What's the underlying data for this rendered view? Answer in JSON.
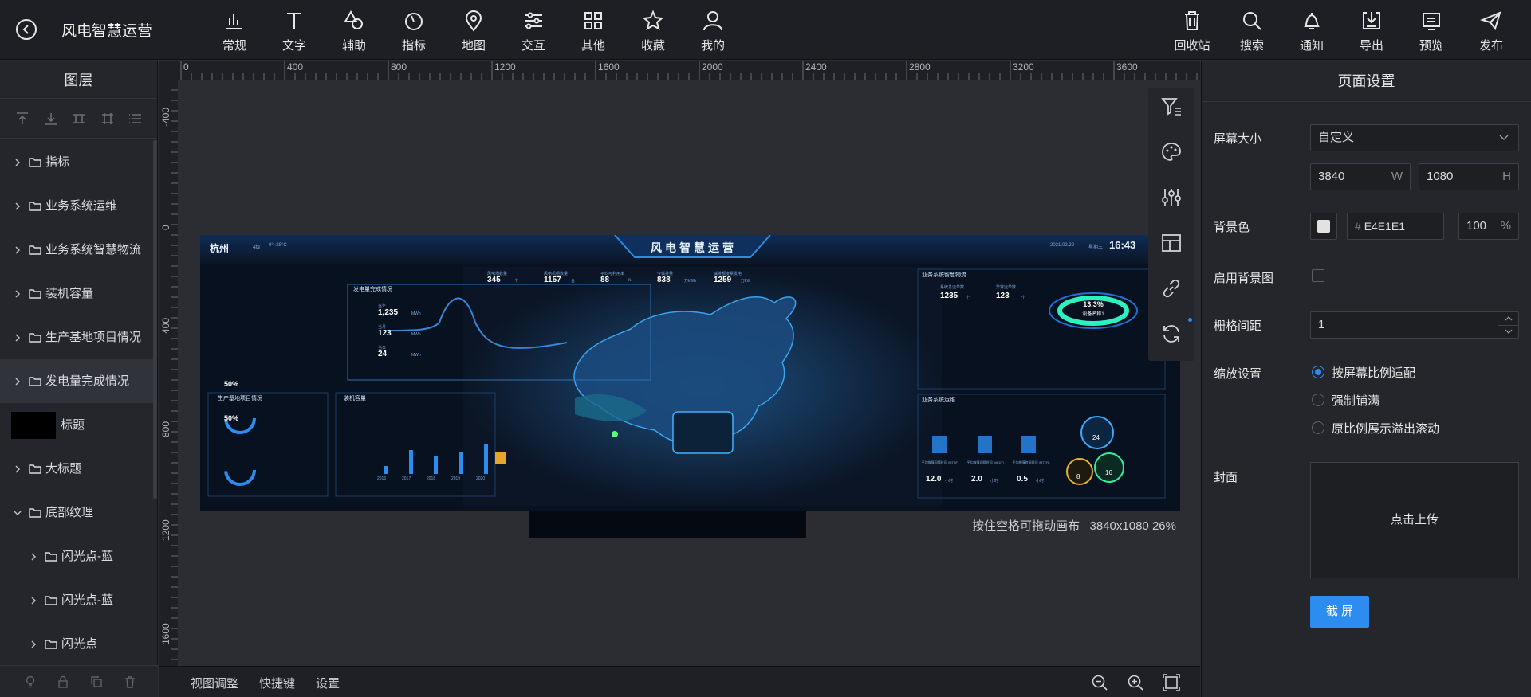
{
  "app": {
    "title": "风电智慧运营"
  },
  "toolbar": {
    "left": [
      {
        "label": "常规",
        "icon": "bar-chart-icon"
      },
      {
        "label": "文字",
        "icon": "text-icon"
      },
      {
        "label": "辅助",
        "icon": "shapes-icon"
      },
      {
        "label": "指标",
        "icon": "gauge-icon"
      },
      {
        "label": "地图",
        "icon": "map-pin-icon"
      },
      {
        "label": "交互",
        "icon": "sliders-icon"
      },
      {
        "label": "其他",
        "icon": "grid-icon"
      },
      {
        "label": "收藏",
        "icon": "star-icon"
      },
      {
        "label": "我的",
        "icon": "user-icon"
      }
    ],
    "right": [
      {
        "label": "回收站",
        "icon": "trash-icon"
      },
      {
        "label": "搜索",
        "icon": "search-icon"
      },
      {
        "label": "通知",
        "icon": "bell-icon"
      },
      {
        "label": "导出",
        "icon": "export-icon"
      },
      {
        "label": "预览",
        "icon": "preview-icon"
      },
      {
        "label": "发布",
        "icon": "send-icon"
      }
    ]
  },
  "layers": {
    "title": "图层",
    "items": [
      {
        "label": "指标",
        "indent": 0,
        "expanded": false
      },
      {
        "label": "业务系统运维",
        "indent": 0,
        "expanded": false
      },
      {
        "label": "业务系统智慧物流",
        "indent": 0,
        "expanded": false
      },
      {
        "label": "装机容量",
        "indent": 0,
        "expanded": false
      },
      {
        "label": "生产基地项目情况",
        "indent": 0,
        "expanded": false
      },
      {
        "label": "发电量完成情况",
        "indent": 0,
        "expanded": false,
        "selected": true
      },
      {
        "label": "标题",
        "indent": 0,
        "thumb": true
      },
      {
        "label": "大标题",
        "indent": 0,
        "expanded": false
      },
      {
        "label": "底部纹理",
        "indent": 0,
        "expanded": true
      },
      {
        "label": "闪光点-蓝",
        "indent": 1,
        "expanded": false
      },
      {
        "label": "闪光点-蓝",
        "indent": 1,
        "expanded": false
      },
      {
        "label": "闪光点",
        "indent": 1,
        "expanded": false
      }
    ]
  },
  "ruler": {
    "h": [
      "0",
      "400",
      "800",
      "1200",
      "1600",
      "2000",
      "2400",
      "2800",
      "3200",
      "3600"
    ],
    "v": [
      "-400",
      "0",
      "400",
      "800",
      "1200",
      "1600"
    ]
  },
  "canvas": {
    "hint": "按住空格可拖动画布",
    "size": "3840x1080",
    "zoom": "26%"
  },
  "dashboard": {
    "city": "杭州",
    "weather": "4级",
    "temp": "0°~28°C",
    "title": "风电智慧运营",
    "date": "2021.02.22",
    "weekday": "星期三",
    "time": "16:43",
    "panels": [
      "发电量完成情况",
      "生产基地项目情况",
      "装机容量",
      "业务系统智慧物流",
      "业务系统运维"
    ],
    "stats": [
      {
        "label": "风电场数量",
        "value": "345",
        "unit": "个"
      },
      {
        "label": "风电机组数量",
        "value": "1157",
        "unit": "台"
      },
      {
        "label": "平均可利用率",
        "value": "88",
        "unit": "%"
      },
      {
        "label": "今城排量",
        "value": "838",
        "unit": "万kWh"
      },
      {
        "label": "减排额度累发电",
        "value": "1259",
        "unit": "万kW"
      }
    ],
    "gen": [
      {
        "label": "当年",
        "value": "1,235",
        "unit": "MWh"
      },
      {
        "label": "当月",
        "value": "123",
        "unit": "MWh"
      },
      {
        "label": "当日",
        "value": "24",
        "unit": "MWh"
      }
    ],
    "logi": [
      {
        "label": "系统总运单数",
        "value": "1235",
        "unit": "个"
      },
      {
        "label": "异常运单数",
        "value": "123",
        "unit": "个"
      }
    ],
    "ring": {
      "value": "13.3%",
      "label": "设备名称1"
    },
    "ops": [
      {
        "label": "平均故障间隔时间 (MTBF)",
        "value": "12.0",
        "unit": "小时"
      },
      {
        "label": "平均故障间隔时间 (MLDT)",
        "value": "2.0",
        "unit": "小时"
      },
      {
        "label": "平均故障修复时间 (MTTR)",
        "value": "0.5",
        "unit": "小时"
      }
    ],
    "bubbles": [
      "24",
      "8",
      "16"
    ],
    "gauges": [
      "50%",
      "50%"
    ],
    "years": [
      "2016",
      "2017",
      "2018",
      "2019",
      "2020"
    ]
  },
  "float_tools": [
    "filter-icon",
    "palette-icon",
    "adjust-icon",
    "layout-icon",
    "link-icon",
    "refresh-icon"
  ],
  "bottom": {
    "links": [
      "视图调整",
      "快捷键",
      "设置"
    ]
  },
  "page_settings": {
    "title": "页面设置",
    "screen_size_label": "屏幕大小",
    "screen_size_value": "自定义",
    "width": "3840",
    "width_unit": "W",
    "height": "1080",
    "height_unit": "H",
    "bg_color_label": "背景色",
    "bg_color_hex": "E4E1E1",
    "bg_color_hash": "#",
    "bg_opacity": "100",
    "bg_opacity_unit": "%",
    "bg_image_label": "启用背景图",
    "grid_label": "栅格间距",
    "grid_value": "1",
    "scale_label": "缩放设置",
    "scale_options": [
      {
        "label": "按屏幕比例适配",
        "checked": true
      },
      {
        "label": "强制铺满",
        "checked": false
      },
      {
        "label": "原比例展示溢出滚动",
        "checked": false
      }
    ],
    "cover_label": "封面",
    "upload_text": "点击上传",
    "screenshot_button": "截 屏"
  },
  "colors": {
    "accent": "#2d8cf0",
    "bg": "#2b2d33",
    "panel": "#24262b"
  }
}
